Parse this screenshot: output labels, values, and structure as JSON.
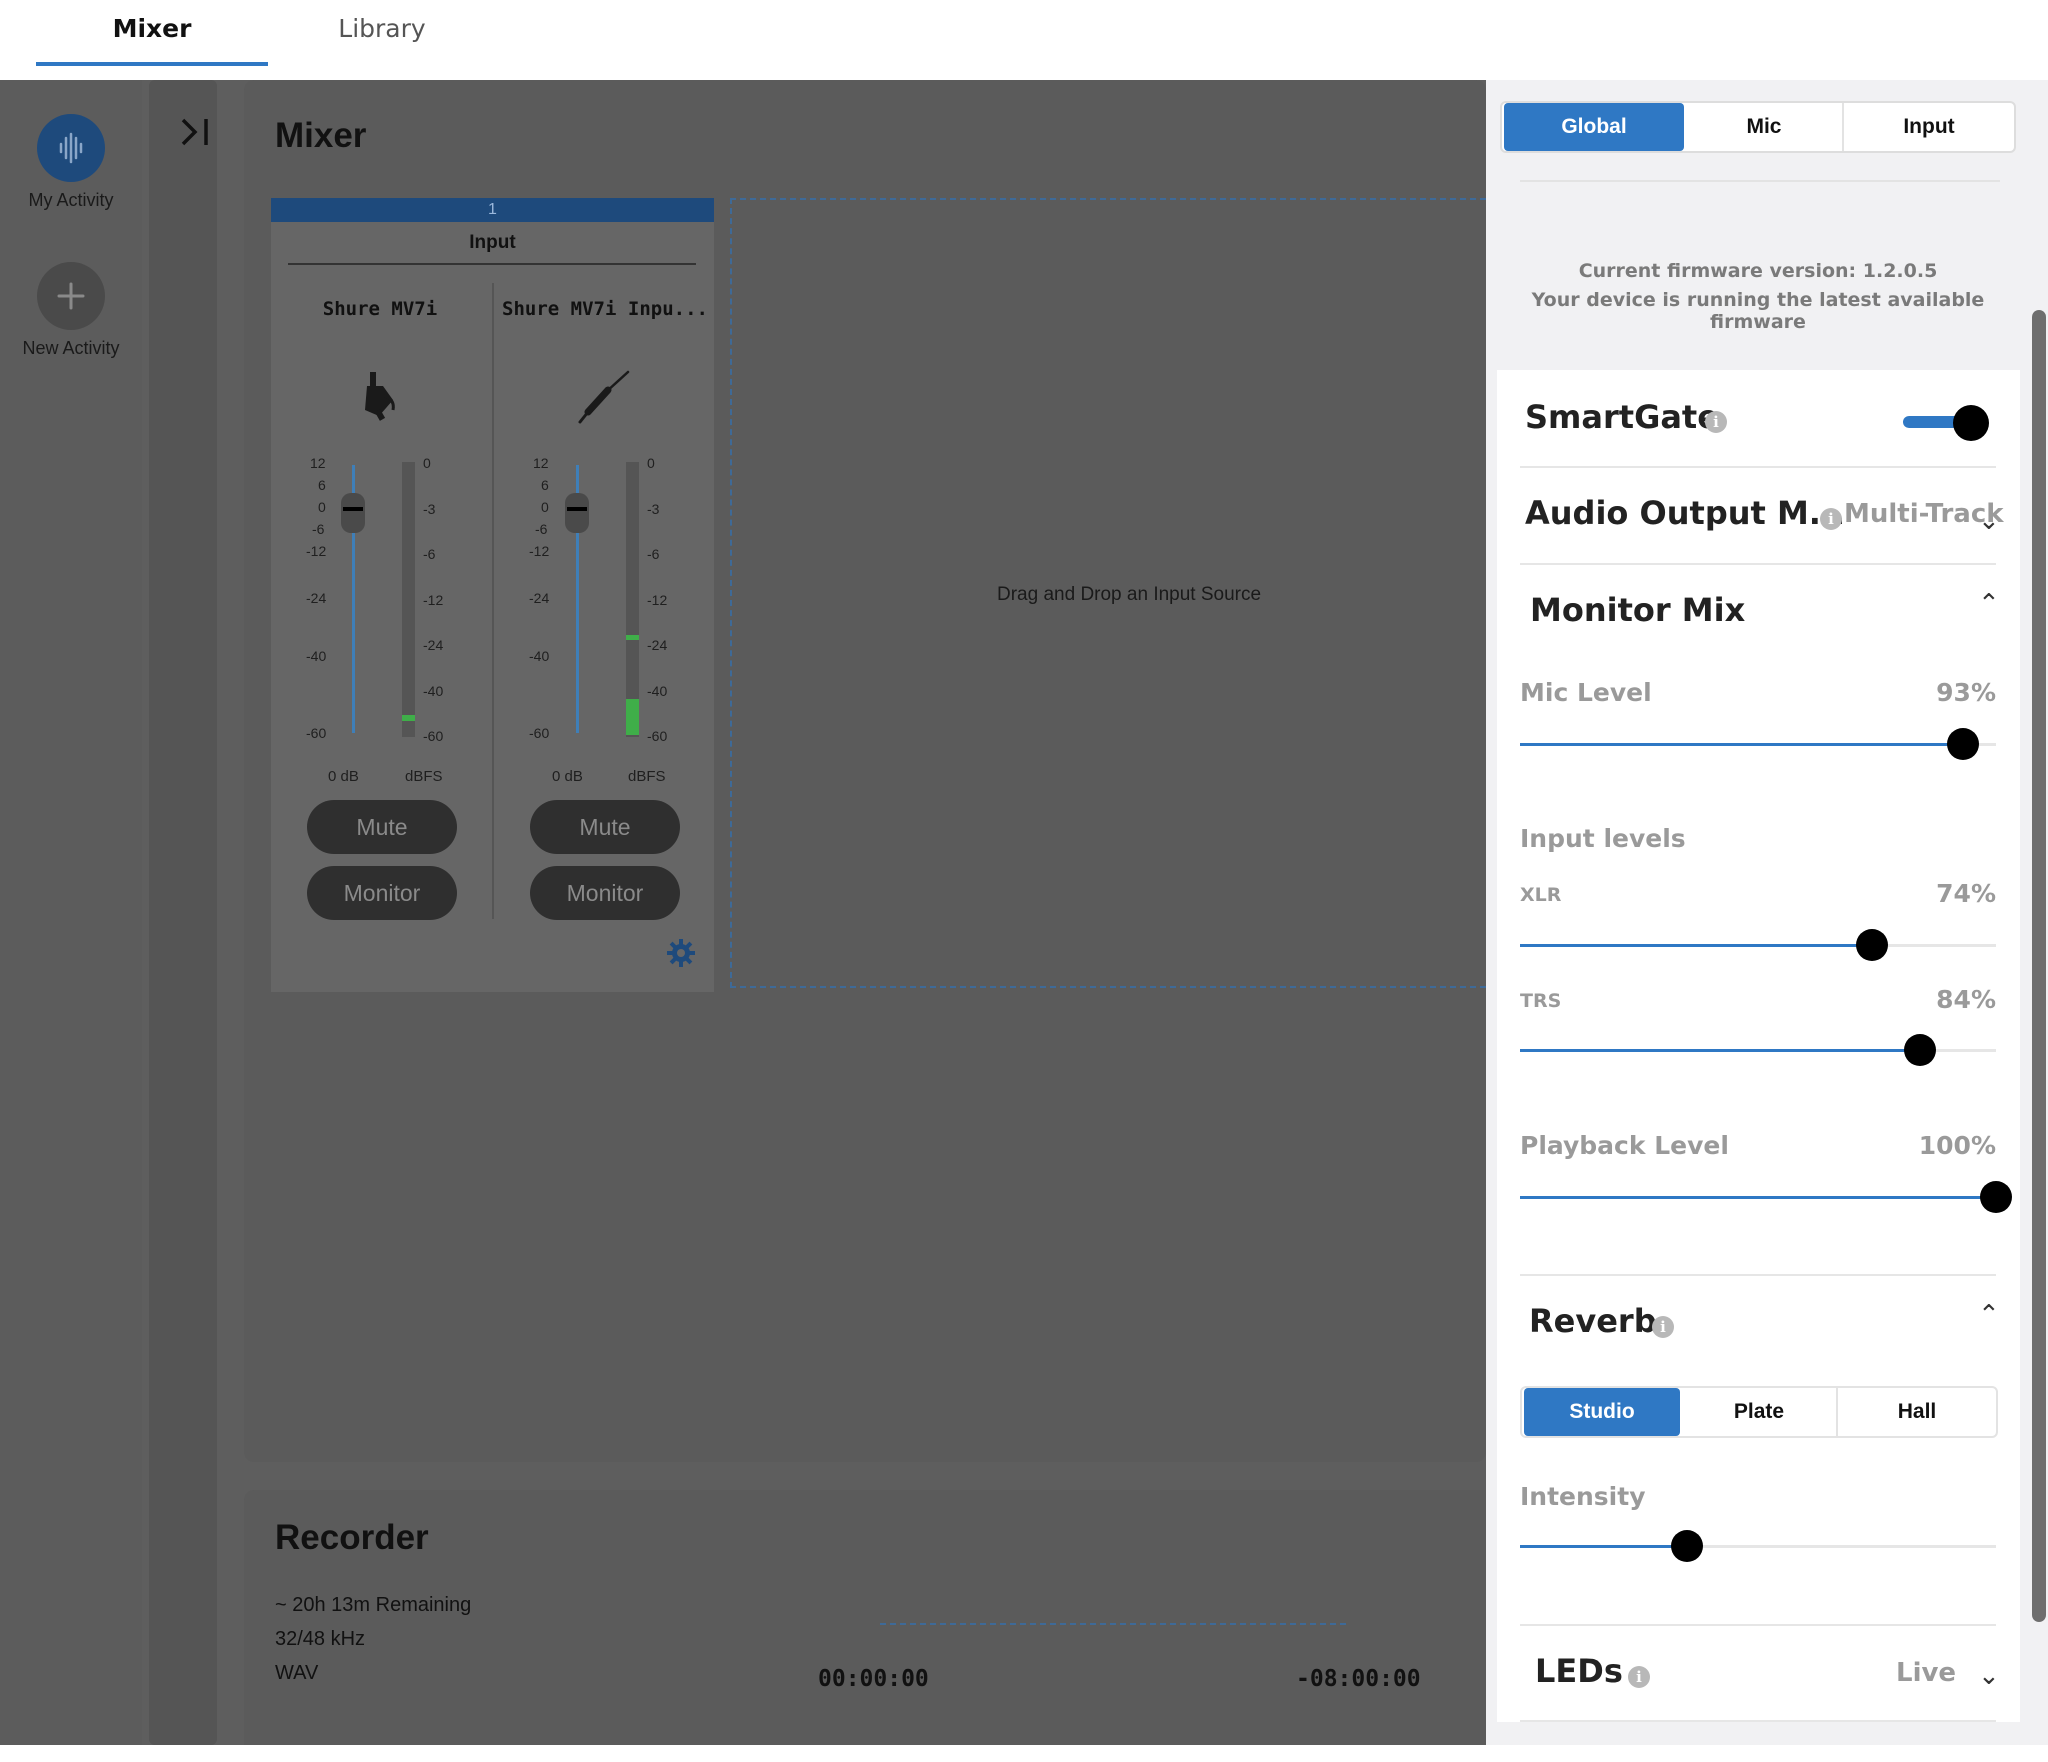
{
  "top_tabs": [
    {
      "label": "Mixer",
      "active": true
    },
    {
      "label": "Library",
      "active": false
    }
  ],
  "nav": {
    "my_activity": "My Activity",
    "new_activity": "New Activity"
  },
  "mixer": {
    "title": "Mixer",
    "strip_number": "1",
    "strip_label": "Input",
    "channels": [
      {
        "name": "Shure MV7i",
        "icon": "microphone-icon",
        "gain_unit": "0 dB",
        "meter_unit": "dBFS",
        "mute": "Mute",
        "monitor": "Monitor"
      },
      {
        "name": "Shure MV7i Inpu...",
        "icon": "instrument-cable-icon",
        "gain_unit": "0 dB",
        "meter_unit": "dBFS",
        "mute": "Mute",
        "monitor": "Monitor"
      }
    ],
    "fader_scale": [
      "12",
      "6",
      "0",
      "-6",
      "-12",
      "-24",
      "-40",
      "-60"
    ],
    "meter_scale": [
      "0",
      "-3",
      "-6",
      "-12",
      "-24",
      "-40",
      "-60"
    ],
    "dropzone": "Drag and Drop an Input Source"
  },
  "recorder": {
    "title": "Recorder",
    "remaining": "~ 20h 13m Remaining",
    "format": "32/48 kHz",
    "filetype": "WAV",
    "time_elapsed": "00:00:00",
    "time_remaining": "-08:00:00"
  },
  "right": {
    "segments": [
      {
        "label": "Global",
        "active": true
      },
      {
        "label": "Mic"
      },
      {
        "label": "Input"
      }
    ],
    "firmware_line1": "Current firmware version: 1.2.0.5",
    "firmware_line2": "Your device is running the latest available firmware",
    "smartgate": {
      "label": "SmartGate",
      "on": true
    },
    "audio_output": {
      "label": "Audio Output M...",
      "value": "Multi-Track"
    },
    "monitor_mix": {
      "title": "Monitor Mix",
      "mic_level": {
        "label": "Mic Level",
        "value": "93%",
        "level": 0.93
      },
      "input_levels_label": "Input levels",
      "xlr": {
        "label": "XLR",
        "value": "74%",
        "level": 0.74
      },
      "trs": {
        "label": "TRS",
        "value": "84%",
        "level": 0.84
      },
      "playback": {
        "label": "Playback Level",
        "value": "100%",
        "level": 1.0
      }
    },
    "reverb": {
      "title": "Reverb",
      "options": [
        {
          "label": "Studio",
          "active": true
        },
        {
          "label": "Plate"
        },
        {
          "label": "Hall"
        }
      ],
      "intensity_label": "Intensity",
      "intensity_level": 0.35
    },
    "leds": {
      "label": "LEDs",
      "value": "Live"
    }
  },
  "colors": {
    "accent": "#2f78c4",
    "strip_header": "#1e4a7c",
    "meter_green": "#3fae49"
  }
}
